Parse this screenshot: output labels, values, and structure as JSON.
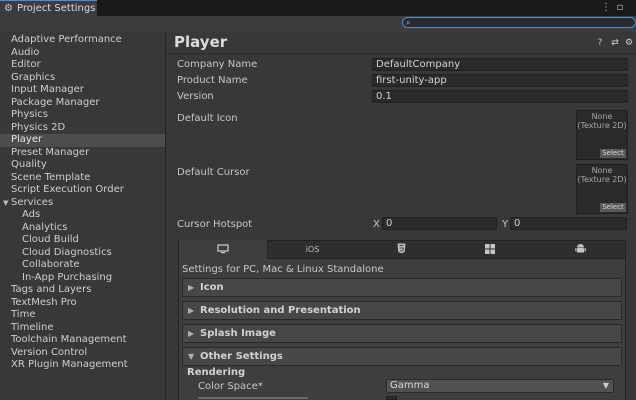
{
  "window": {
    "tab_label": "Project Settings",
    "icons": [
      "gear-icon",
      "more-icon",
      "maximize-icon"
    ]
  },
  "search": {
    "placeholder": ""
  },
  "sidebar": {
    "items": [
      {
        "label": "Adaptive Performance"
      },
      {
        "label": "Audio"
      },
      {
        "label": "Editor"
      },
      {
        "label": "Graphics"
      },
      {
        "label": "Input Manager"
      },
      {
        "label": "Package Manager"
      },
      {
        "label": "Physics"
      },
      {
        "label": "Physics 2D"
      },
      {
        "label": "Player",
        "selected": true
      },
      {
        "label": "Preset Manager"
      },
      {
        "label": "Quality"
      },
      {
        "label": "Scene Template"
      },
      {
        "label": "Script Execution Order"
      },
      {
        "label": "Services",
        "expanded": true
      },
      {
        "label": "Ads",
        "indent": 1
      },
      {
        "label": "Analytics",
        "indent": 1
      },
      {
        "label": "Cloud Build",
        "indent": 1
      },
      {
        "label": "Cloud Diagnostics",
        "indent": 1
      },
      {
        "label": "Collaborate",
        "indent": 1
      },
      {
        "label": "In-App Purchasing",
        "indent": 1
      },
      {
        "label": "Tags and Layers"
      },
      {
        "label": "TextMesh Pro"
      },
      {
        "label": "Time"
      },
      {
        "label": "Timeline"
      },
      {
        "label": "Toolchain Management"
      },
      {
        "label": "Version Control"
      },
      {
        "label": "XR Plugin Management"
      }
    ]
  },
  "main": {
    "title": "Player",
    "header_icons": [
      "help-icon",
      "preset-icon",
      "settings-icon"
    ],
    "fields": {
      "company_name": {
        "label": "Company Name",
        "value": "DefaultCompany"
      },
      "product_name": {
        "label": "Product Name",
        "value": "first-unity-app"
      },
      "version": {
        "label": "Version",
        "value": "0.1"
      },
      "default_icon": {
        "label": "Default Icon",
        "slot_line1": "None",
        "slot_line2": "(Texture 2D)",
        "select": "Select"
      },
      "default_cursor": {
        "label": "Default Cursor",
        "slot_line1": "None",
        "slot_line2": "(Texture 2D)",
        "select": "Select"
      },
      "cursor_hotspot": {
        "label": "Cursor Hotspot",
        "x_label": "X",
        "x_value": "0",
        "y_label": "Y",
        "y_value": "0"
      }
    },
    "platform_tabs": [
      {
        "name": "standalone",
        "icon": "monitor-icon",
        "active": true
      },
      {
        "name": "ios",
        "label": "iOS"
      },
      {
        "name": "webgl",
        "icon": "html5-icon"
      },
      {
        "name": "windows",
        "icon": "windows-icon"
      },
      {
        "name": "android",
        "icon": "android-icon"
      }
    ],
    "settings_for": "Settings for PC, Mac & Linux Standalone",
    "foldouts": [
      {
        "label": "Icon",
        "expanded": false
      },
      {
        "label": "Resolution and Presentation",
        "expanded": false
      },
      {
        "label": "Splash Image",
        "expanded": false
      },
      {
        "label": "Other Settings",
        "expanded": true
      }
    ],
    "rendering": {
      "heading": "Rendering",
      "color_space_label": "Color Space*",
      "color_space_value": "Gamma"
    }
  }
}
